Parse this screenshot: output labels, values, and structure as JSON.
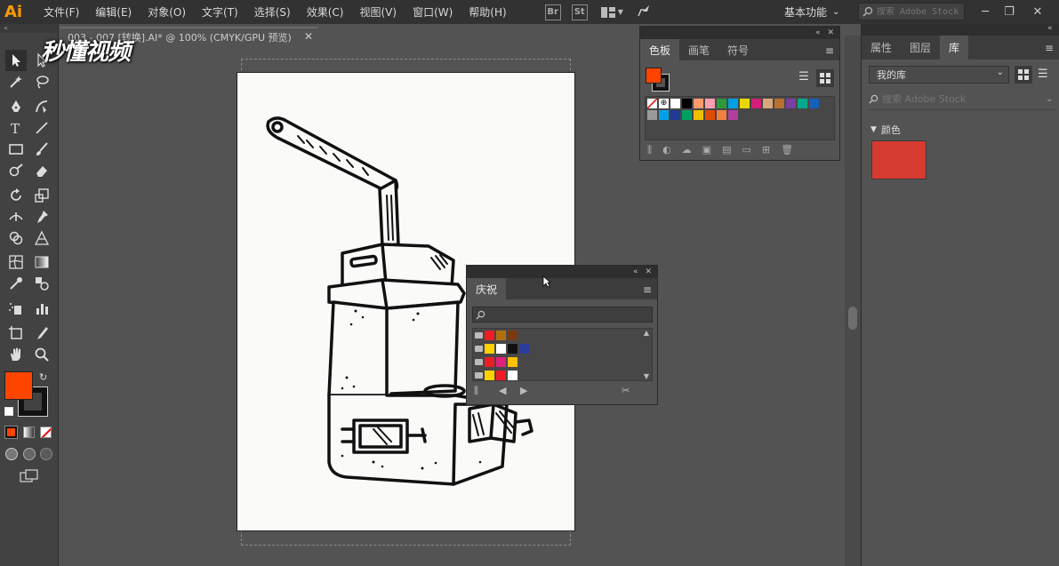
{
  "app": {
    "logo": "Ai"
  },
  "menu": [
    "文件(F)",
    "编辑(E)",
    "对象(O)",
    "文字(T)",
    "选择(S)",
    "效果(C)",
    "视图(V)",
    "窗口(W)",
    "帮助(H)"
  ],
  "app_icons": [
    "Br",
    "St"
  ],
  "workspace": {
    "label": "基本功能"
  },
  "stock_search": {
    "placeholder": "搜索 Adobe Stock"
  },
  "document": {
    "tab_label": "003 - 007 [转换].AI* @ 100% (CMYK/GPU 预览)"
  },
  "watermark": {
    "text": "秒懂视频"
  },
  "swatches_panel": {
    "tabs": [
      "色板",
      "画笔",
      "符号"
    ],
    "active_tab": 0,
    "fill_color": "#ff4400",
    "row1": [
      "#ffffff",
      "#000000",
      "#ff9a6a",
      "#ff9fb0",
      "#2a9a3a",
      "#00a1e0",
      "#e8d800",
      "#d41e78",
      "#d9a87a",
      "#b87030",
      "#7a3fa0",
      "#00a88c",
      "#1560b8"
    ],
    "row2": [
      "#9a9a9a",
      "#00a0e8",
      "#1f3a90",
      "#00a060",
      "#f0c000",
      "#e04a00",
      "#f08040",
      "#b040a0"
    ]
  },
  "celebration_panel": {
    "title": "庆祝",
    "search_placeholder": "",
    "groups": [
      [
        "#ee1c24",
        "#b07010",
        "#7a3a10"
      ],
      [
        "#ffd000",
        "#ffffff",
        "#111111",
        "#2b3c9a"
      ],
      [
        "#ee1c24",
        "#e0207a",
        "#ffc000"
      ],
      [
        "#ffd000",
        "#ee1c24",
        "#ffffff"
      ]
    ]
  },
  "library_panel": {
    "tabs": [
      "属性",
      "图层",
      "库"
    ],
    "active_tab": 2,
    "library_name": "我的库",
    "search_placeholder": "搜索 Adobe Stock",
    "section_title": "颜色",
    "color_swatch": "#d63a30"
  },
  "toolbar": {
    "fill": "#ff4400",
    "stroke": "#111111"
  }
}
